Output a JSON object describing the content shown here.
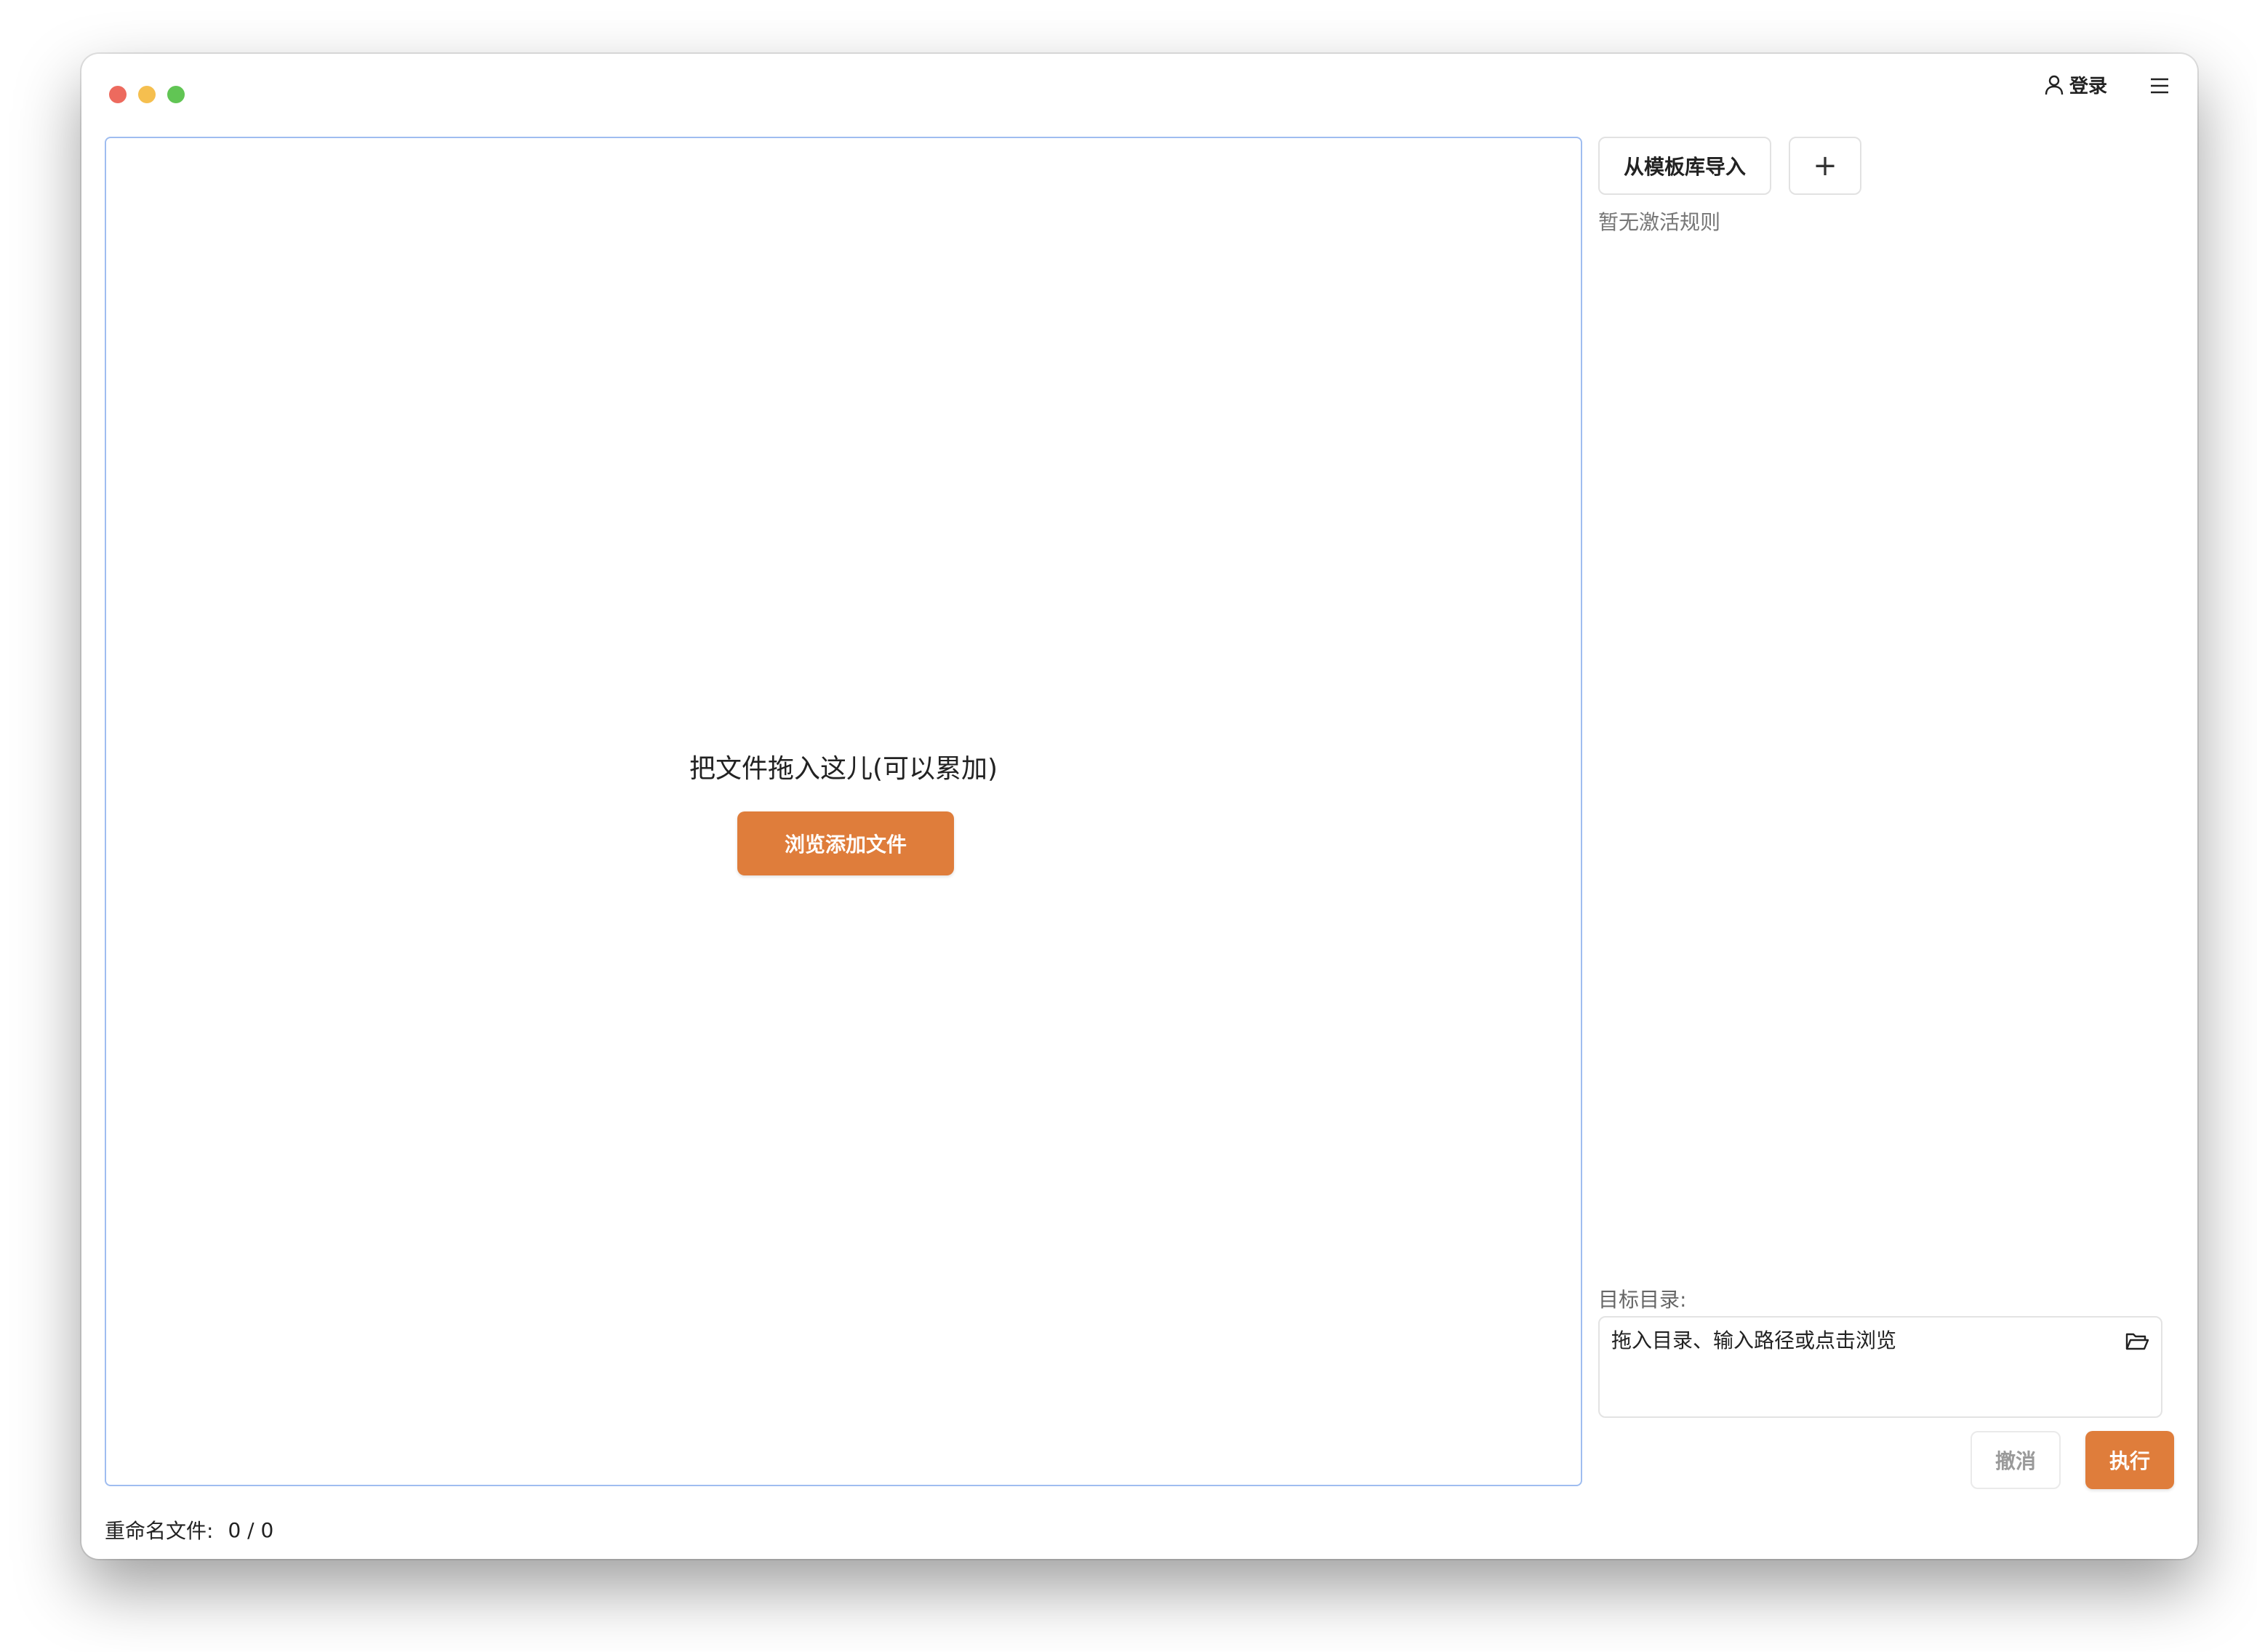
{
  "window": {
    "traffic_lights": {
      "close_color": "#ed6a5e",
      "minimize_color": "#f5bf4f",
      "maximize_color": "#61c554"
    }
  },
  "header": {
    "login_label": "登录",
    "login_icon": "user-icon",
    "menu_icon": "hamburger-menu-icon"
  },
  "dropzone": {
    "hint": "把文件拖入这儿(可以累加)",
    "browse_button": "浏览添加文件"
  },
  "rules": {
    "import_template_button": "从模板库导入",
    "add_button": "+",
    "empty_text": "暂无激活规则"
  },
  "target": {
    "label": "目标目录:",
    "placeholder": "拖入目录、输入路径或点击浏览",
    "value": "",
    "folder_icon": "folder-open-icon"
  },
  "actions": {
    "undo_label": "撤消",
    "execute_label": "执行"
  },
  "status": {
    "label": "重命名文件:",
    "count": "0 / 0"
  },
  "colors": {
    "accent": "#df7d3b",
    "dropzone_border": "#9fbdf0"
  }
}
